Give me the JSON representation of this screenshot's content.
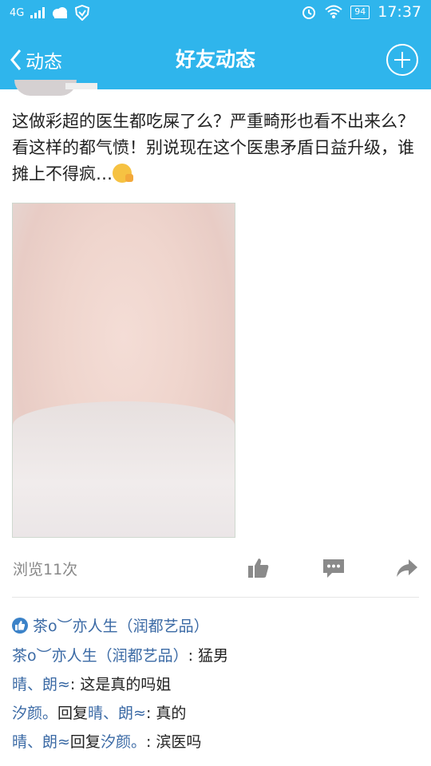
{
  "status_bar": {
    "network": "4G",
    "battery": "94",
    "time": "17:37"
  },
  "nav": {
    "back_label": "动态",
    "title": "好友动态"
  },
  "post": {
    "text": "这做彩超的医生都吃屎了么？严重畸形也看不出来么？看这样的都气愤！别说现在这个医患矛盾日益升级，谁摊上不得疯…",
    "views": "浏览11次"
  },
  "likes": {
    "names": "茶o︶亦人生（润都艺品）"
  },
  "comments": [
    {
      "user": "茶o︶亦人生（润都艺品）",
      "reply_word": "",
      "target": "",
      "sep": ": ",
      "text": "猛男"
    },
    {
      "user": "晴、朗≈",
      "reply_word": "",
      "target": "",
      "sep": ": ",
      "text": "这是真的吗姐"
    },
    {
      "user": "汐颜。",
      "reply_word": "回复",
      "target": "晴、朗≈",
      "sep": ": ",
      "text": "真的"
    },
    {
      "user": "晴、朗≈",
      "reply_word": "回复",
      "target": "汐颜。",
      "sep": ": ",
      "text": "滨医吗"
    }
  ]
}
